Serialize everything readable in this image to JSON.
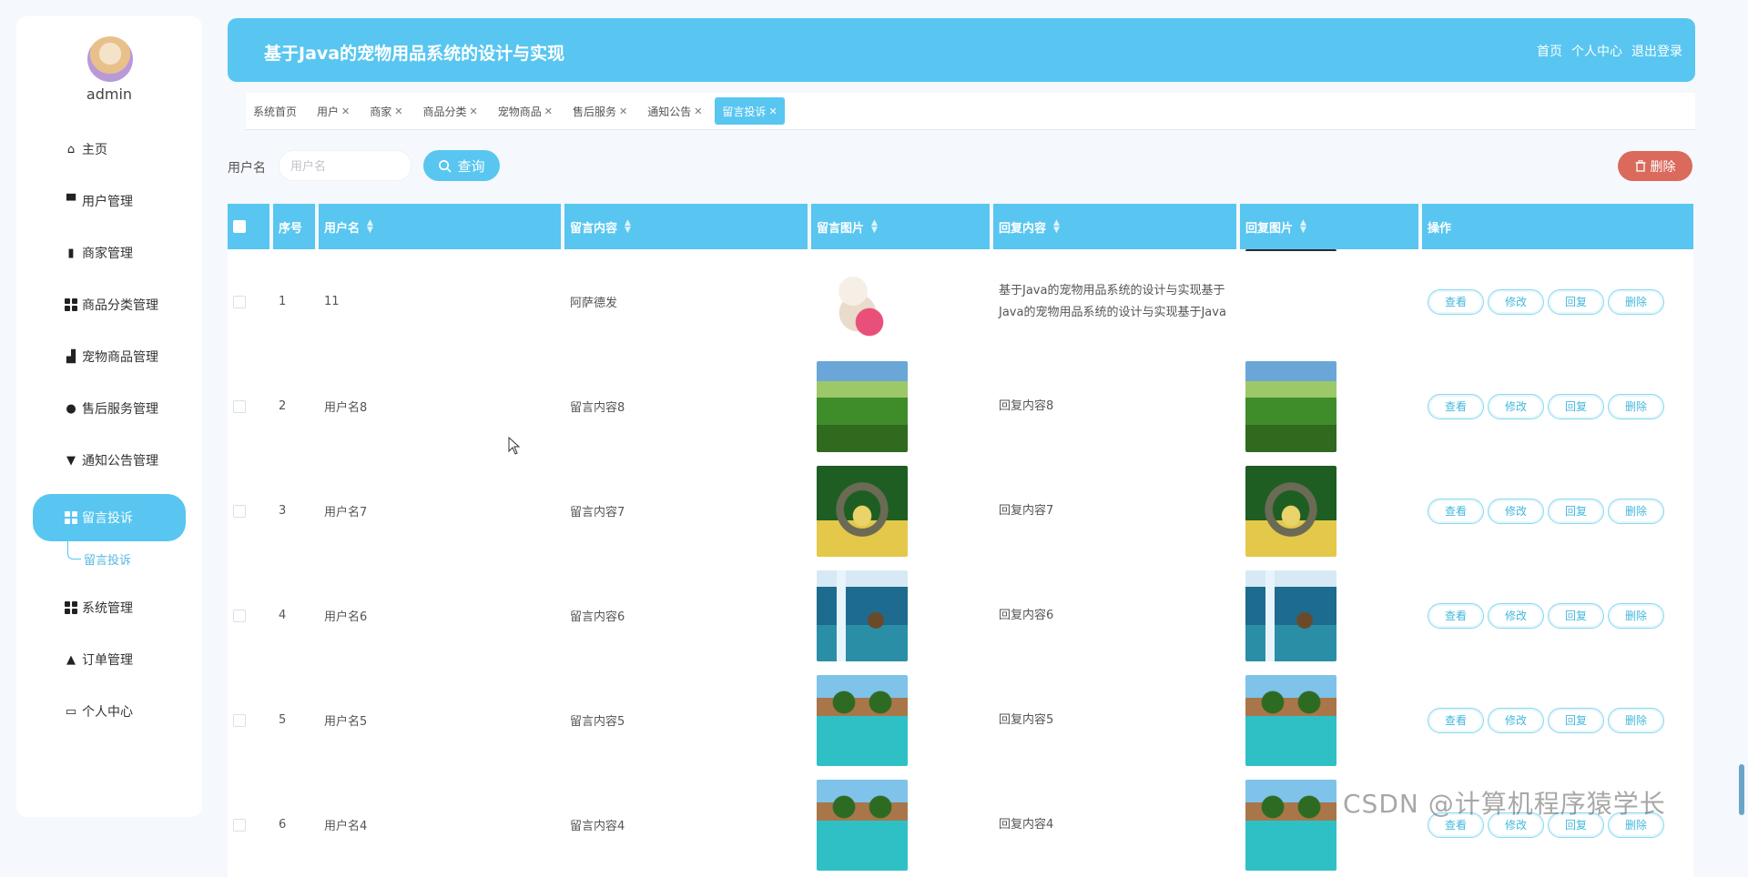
{
  "sidebar": {
    "username": "admin",
    "items": [
      {
        "label": "主页",
        "icon": "home-icon"
      },
      {
        "label": "用户管理",
        "icon": "monitor-icon"
      },
      {
        "label": "商家管理",
        "icon": "clipboard-icon"
      },
      {
        "label": "商品分类管理",
        "icon": "grid-icon"
      },
      {
        "label": "宠物商品管理",
        "icon": "bar-chart-icon"
      },
      {
        "label": "售后服务管理",
        "icon": "user-icon"
      },
      {
        "label": "通知公告管理",
        "icon": "flag-icon"
      },
      {
        "label": "留言投诉",
        "icon": "grid-icon"
      },
      {
        "label": "系统管理",
        "icon": "grid-icon"
      },
      {
        "label": "订单管理",
        "icon": "user-icon"
      },
      {
        "label": "个人中心",
        "icon": "card-icon"
      }
    ],
    "sub_item": "留言投诉"
  },
  "header": {
    "title": "基于Java的宠物用品系统的设计与实现",
    "links": [
      "首页",
      "个人中心",
      "退出登录"
    ]
  },
  "tabs": [
    {
      "label": "系统首页",
      "closable": false
    },
    {
      "label": "用户",
      "closable": true
    },
    {
      "label": "商家",
      "closable": true
    },
    {
      "label": "商品分类",
      "closable": true
    },
    {
      "label": "宠物商品",
      "closable": true
    },
    {
      "label": "售后服务",
      "closable": true
    },
    {
      "label": "通知公告",
      "closable": true
    },
    {
      "label": "留言投诉",
      "closable": true
    }
  ],
  "search": {
    "label": "用户名",
    "placeholder": "用户名",
    "query_label": "查询",
    "delete_label": "删除"
  },
  "table": {
    "columns": [
      "序号",
      "用户名",
      "留言内容",
      "留言图片",
      "回复内容",
      "回复图片",
      "操作"
    ],
    "actions": [
      "查看",
      "修改",
      "回复",
      "删除"
    ],
    "rows": [
      {
        "index": "1",
        "username": "11",
        "message": "阿萨德发",
        "reply": "基于Java的宠物用品系统的设计与实现基于Java的宠物用品系统的设计与实现基于Java",
        "msg_img": "cat",
        "reply_img": "none"
      },
      {
        "index": "2",
        "username": "用户名8",
        "message": "留言内容8",
        "reply": "回复内容8",
        "msg_img": "field",
        "reply_img": "field"
      },
      {
        "index": "3",
        "username": "用户名7",
        "message": "留言内容7",
        "reply": "回复内容7",
        "msg_img": "arch",
        "reply_img": "arch"
      },
      {
        "index": "4",
        "username": "用户名6",
        "message": "留言内容6",
        "reply": "回复内容6",
        "msg_img": "waterfall",
        "reply_img": "waterfall"
      },
      {
        "index": "5",
        "username": "用户名5",
        "message": "留言内容5",
        "reply": "回复内容5",
        "msg_img": "resort",
        "reply_img": "resort"
      },
      {
        "index": "6",
        "username": "用户名4",
        "message": "留言内容4",
        "reply": "回复内容4",
        "msg_img": "resort",
        "reply_img": "resort"
      }
    ]
  },
  "watermark": "CSDN @计算机程序猿学长"
}
